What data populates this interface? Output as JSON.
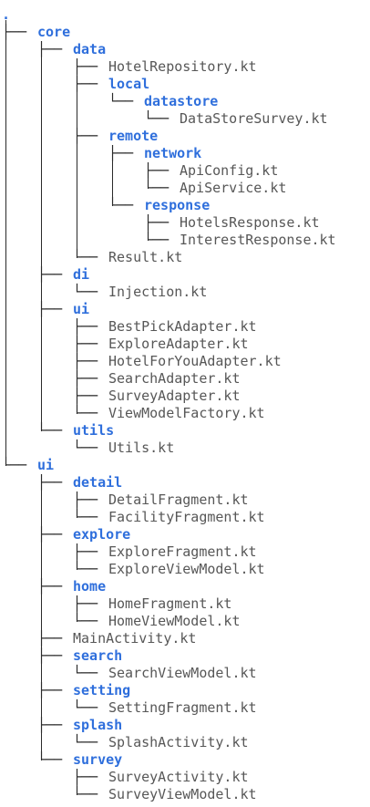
{
  "tree": {
    "root_label": ".",
    "rows": [
      {
        "label": "core",
        "kind": "dir",
        "depth": 0,
        "icon": "folder-icon"
      },
      {
        "label": "data",
        "kind": "dir",
        "depth": 1,
        "icon": "folder-icon"
      },
      {
        "label": "HotelRepository.kt",
        "kind": "file",
        "depth": 2,
        "icon": "file-icon"
      },
      {
        "label": "local",
        "kind": "dir",
        "depth": 2,
        "icon": "folder-icon"
      },
      {
        "label": "datastore",
        "kind": "dir",
        "depth": 3,
        "icon": "folder-icon"
      },
      {
        "label": "DataStoreSurvey.kt",
        "kind": "file",
        "depth": 4,
        "icon": "file-icon"
      },
      {
        "label": "remote",
        "kind": "dir",
        "depth": 2,
        "icon": "folder-icon"
      },
      {
        "label": "network",
        "kind": "dir",
        "depth": 3,
        "icon": "folder-icon"
      },
      {
        "label": "ApiConfig.kt",
        "kind": "file",
        "depth": 4,
        "icon": "file-icon"
      },
      {
        "label": "ApiService.kt",
        "kind": "file",
        "depth": 4,
        "icon": "file-icon"
      },
      {
        "label": "response",
        "kind": "dir",
        "depth": 3,
        "icon": "folder-icon"
      },
      {
        "label": "HotelsResponse.kt",
        "kind": "file",
        "depth": 4,
        "icon": "file-icon"
      },
      {
        "label": "InterestResponse.kt",
        "kind": "file",
        "depth": 4,
        "icon": "file-icon"
      },
      {
        "label": "Result.kt",
        "kind": "file",
        "depth": 2,
        "icon": "file-icon"
      },
      {
        "label": "di",
        "kind": "dir",
        "depth": 1,
        "icon": "folder-icon"
      },
      {
        "label": "Injection.kt",
        "kind": "file",
        "depth": 2,
        "icon": "file-icon"
      },
      {
        "label": "ui",
        "kind": "dir",
        "depth": 1,
        "icon": "folder-icon"
      },
      {
        "label": "BestPickAdapter.kt",
        "kind": "file",
        "depth": 2,
        "icon": "file-icon"
      },
      {
        "label": "ExploreAdapter.kt",
        "kind": "file",
        "depth": 2,
        "icon": "file-icon"
      },
      {
        "label": "HotelForYouAdapter.kt",
        "kind": "file",
        "depth": 2,
        "icon": "file-icon"
      },
      {
        "label": "SearchAdapter.kt",
        "kind": "file",
        "depth": 2,
        "icon": "file-icon"
      },
      {
        "label": "SurveyAdapter.kt",
        "kind": "file",
        "depth": 2,
        "icon": "file-icon"
      },
      {
        "label": "ViewModelFactory.kt",
        "kind": "file",
        "depth": 2,
        "icon": "file-icon"
      },
      {
        "label": "utils",
        "kind": "dir",
        "depth": 1,
        "icon": "folder-icon"
      },
      {
        "label": "Utils.kt",
        "kind": "file",
        "depth": 2,
        "icon": "file-icon"
      },
      {
        "label": "ui",
        "kind": "dir",
        "depth": 0,
        "icon": "folder-icon"
      },
      {
        "label": "detail",
        "kind": "dir",
        "depth": 1,
        "icon": "folder-icon"
      },
      {
        "label": "DetailFragment.kt",
        "kind": "file",
        "depth": 2,
        "icon": "file-icon"
      },
      {
        "label": "FacilityFragment.kt",
        "kind": "file",
        "depth": 2,
        "icon": "file-icon"
      },
      {
        "label": "explore",
        "kind": "dir",
        "depth": 1,
        "icon": "folder-icon"
      },
      {
        "label": "ExploreFragment.kt",
        "kind": "file",
        "depth": 2,
        "icon": "file-icon"
      },
      {
        "label": "ExploreViewModel.kt",
        "kind": "file",
        "depth": 2,
        "icon": "file-icon"
      },
      {
        "label": "home",
        "kind": "dir",
        "depth": 1,
        "icon": "folder-icon"
      },
      {
        "label": "HomeFragment.kt",
        "kind": "file",
        "depth": 2,
        "icon": "file-icon"
      },
      {
        "label": "HomeViewModel.kt",
        "kind": "file",
        "depth": 2,
        "icon": "file-icon"
      },
      {
        "label": "MainActivity.kt",
        "kind": "file",
        "depth": 1,
        "icon": "file-icon"
      },
      {
        "label": "search",
        "kind": "dir",
        "depth": 1,
        "icon": "folder-icon"
      },
      {
        "label": "SearchViewModel.kt",
        "kind": "file",
        "depth": 2,
        "icon": "file-icon"
      },
      {
        "label": "setting",
        "kind": "dir",
        "depth": 1,
        "icon": "folder-icon"
      },
      {
        "label": "SettingFragment.kt",
        "kind": "file",
        "depth": 2,
        "icon": "file-icon"
      },
      {
        "label": "splash",
        "kind": "dir",
        "depth": 1,
        "icon": "folder-icon"
      },
      {
        "label": "SplashActivity.kt",
        "kind": "file",
        "depth": 2,
        "icon": "file-icon"
      },
      {
        "label": "survey",
        "kind": "dir",
        "depth": 1,
        "icon": "folder-icon"
      },
      {
        "label": "SurveyActivity.kt",
        "kind": "file",
        "depth": 2,
        "icon": "file-icon"
      },
      {
        "label": "SurveyViewModel.kt",
        "kind": "file",
        "depth": 2,
        "icon": "file-icon"
      }
    ]
  },
  "colors": {
    "dir": "#2f6fdc",
    "file": "#575757",
    "line": "#2a2a2a",
    "background": "#ffffff"
  }
}
